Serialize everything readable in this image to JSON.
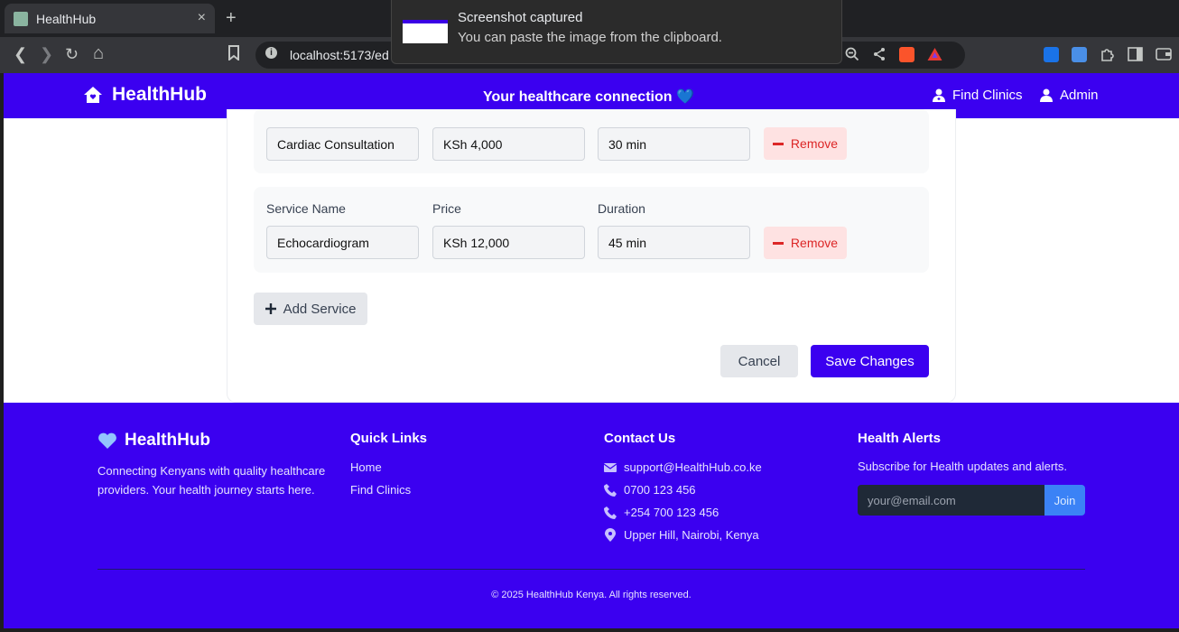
{
  "browser": {
    "tab_title": "HealthHub",
    "tab_close": "×",
    "new_tab": "+",
    "url": "localhost:5173/ed",
    "back": "❮",
    "forward": "❯",
    "reload": "↻",
    "home": "⌂"
  },
  "toast": {
    "title": "Screenshot captured",
    "message": "You can paste the image from the clipboard."
  },
  "navbar": {
    "brand": "HealthHub",
    "tagline": "Your healthcare connection 💙",
    "find_clinics": "Find Clinics",
    "admin": "Admin"
  },
  "services": [
    {
      "name": "Cardiac Consultation",
      "price": "KSh 4,000",
      "duration": "30 min",
      "remove": "Remove"
    },
    {
      "name_label": "Service Name",
      "price_label": "Price",
      "duration_label": "Duration",
      "name": "Echocardiogram",
      "price": "KSh 12,000",
      "duration": "45 min",
      "remove": "Remove"
    }
  ],
  "form": {
    "add_service": "Add Service",
    "cancel": "Cancel",
    "save": "Save Changes"
  },
  "footer": {
    "brand": "HealthHub",
    "description": "Connecting Kenyans with quality healthcare providers. Your health journey starts here.",
    "quick_links_title": "Quick Links",
    "links": [
      "Home",
      "Find Clinics"
    ],
    "contact_title": "Contact Us",
    "contacts": [
      {
        "icon": "envelope-icon",
        "text": "support@HealthHub.co.ke"
      },
      {
        "icon": "phone-icon",
        "text": "0700 123 456"
      },
      {
        "icon": "phone-icon",
        "text": "+254 700 123 456"
      },
      {
        "icon": "location-pin-icon",
        "text": "Upper Hill, Nairobi, Kenya"
      }
    ],
    "alerts_title": "Health Alerts",
    "alerts_text": "Subscribe for Health updates and alerts.",
    "email_placeholder": "your@email.com",
    "join": "Join",
    "copyright": "© 2025 HealthHub Kenya. All rights reserved."
  },
  "colors": {
    "primary": "#3b00f0",
    "danger": "#dc2626",
    "danger_bg": "#fee2e2",
    "join": "#3b82f6"
  }
}
